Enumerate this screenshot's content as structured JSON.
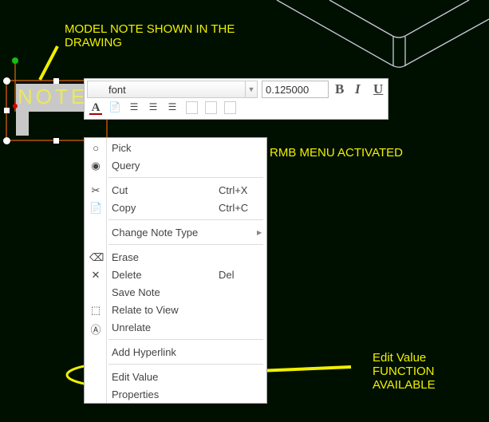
{
  "annotations": {
    "model_note": "MODEL NOTE SHOWN IN THE DRAWING",
    "rmb_menu": "RMB MENU ACTIVATED",
    "edit_value": "Edit Value FUNCTION AVAILABLE",
    "color": "#f0f000"
  },
  "note": {
    "text": "NOTES"
  },
  "toolbar": {
    "font": "font",
    "size": "0.125000",
    "bold": "B",
    "italic": "I",
    "underline": "U"
  },
  "menu": {
    "items": [
      {
        "label": "Pick",
        "icon": "radio-empty-icon",
        "shortcut": ""
      },
      {
        "label": "Query",
        "icon": "radio-checked-icon",
        "shortcut": ""
      },
      {
        "label": "Cut",
        "icon": "scissors-icon",
        "shortcut": "Ctrl+X"
      },
      {
        "label": "Copy",
        "icon": "copy-icon",
        "shortcut": "Ctrl+C"
      },
      {
        "label": "Change Note Type",
        "icon": "",
        "shortcut": "",
        "submenu": true
      },
      {
        "label": "Erase",
        "icon": "eraser-icon",
        "shortcut": ""
      },
      {
        "label": "Delete",
        "icon": "x-icon",
        "shortcut": "Del"
      },
      {
        "label": "Save Note",
        "icon": "",
        "shortcut": ""
      },
      {
        "label": "Relate to View",
        "icon": "relate-view-icon",
        "shortcut": ""
      },
      {
        "label": "Unrelate",
        "icon": "unrelate-icon",
        "shortcut": ""
      },
      {
        "label": "Add Hyperlink",
        "icon": "",
        "shortcut": ""
      },
      {
        "label": "Edit Value",
        "icon": "",
        "shortcut": ""
      },
      {
        "label": "Properties",
        "icon": "",
        "shortcut": ""
      }
    ]
  }
}
